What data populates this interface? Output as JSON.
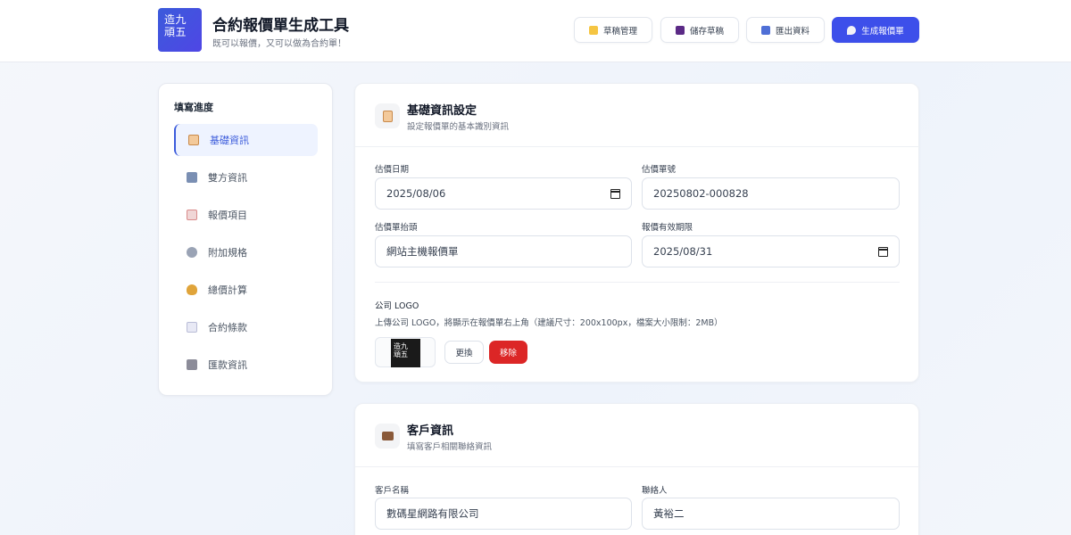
{
  "header": {
    "logo_text_line1": "造九",
    "logo_text_line2": "頑五",
    "title": "合約報價單生成工具",
    "subtitle": "既可以報價，又可以做為合約單！",
    "buttons": {
      "drafts": "草稿管理",
      "save_draft": "儲存草稿",
      "export": "匯出資料",
      "generate": "生成報價單"
    }
  },
  "sidebar": {
    "title": "填寫進度",
    "items": [
      {
        "label": "基礎資訊",
        "icon": "clipboard-icon",
        "active": true
      },
      {
        "label": "雙方資訊",
        "icon": "building-icon",
        "active": false
      },
      {
        "label": "報價項目",
        "icon": "memo-icon",
        "active": false
      },
      {
        "label": "附加規格",
        "icon": "gear-icon",
        "active": false
      },
      {
        "label": "總價計算",
        "icon": "money-bag-icon",
        "active": false
      },
      {
        "label": "合約條款",
        "icon": "document-icon",
        "active": false
      },
      {
        "label": "匯款資訊",
        "icon": "bank-icon",
        "active": false
      }
    ]
  },
  "basic_info": {
    "title": "基礎資訊設定",
    "subtitle": "設定報價單的基本識別資訊",
    "fields": {
      "date_label": "估價日期",
      "date_value": "2025/08/06",
      "number_label": "估價單號",
      "number_value": "20250802-000828",
      "heading_label": "估價單抬頭",
      "heading_value": "網站主機報價單",
      "validity_label": "報價有效期限",
      "validity_value": "2025/08/31"
    },
    "logo": {
      "label": "公司 LOGO",
      "hint": "上傳公司 LOGO，將顯示在報價單右上角（建議尺寸：200x100px，檔案大小限制：2MB）",
      "preview_line1": "造九",
      "preview_line2": "頑五",
      "replace_label": "更換",
      "remove_label": "移除"
    }
  },
  "client_info": {
    "title": "客戶資訊",
    "subtitle": "填寫客戶相關聯絡資訊",
    "fields": {
      "name_label": "客戶名稱",
      "name_value": "數碼星網路有限公司",
      "contact_label": "聯絡人",
      "contact_value": "黃裕二"
    }
  },
  "colors": {
    "accent": "#3d4fea",
    "danger": "#dc2626"
  }
}
